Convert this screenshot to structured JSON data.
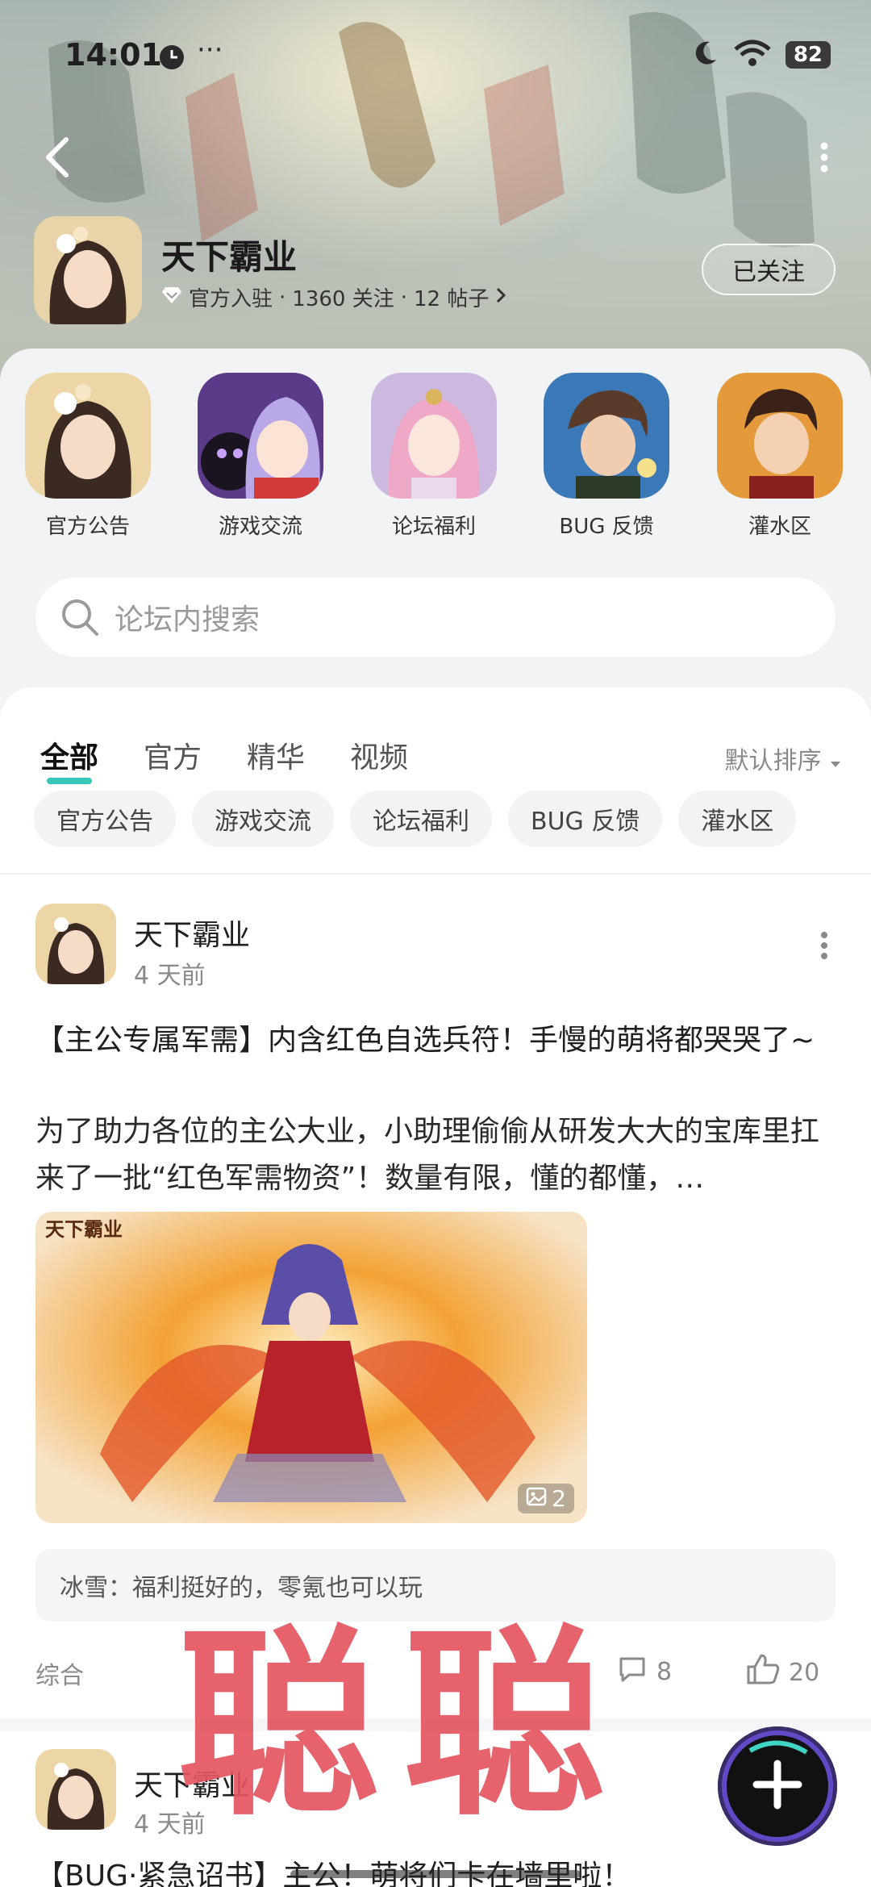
{
  "status_bar": {
    "time": "14:01",
    "battery": "82"
  },
  "forum": {
    "title": "天下霸业",
    "meta_verified": "官方入驻",
    "meta_follow": "1360 关注",
    "meta_posts": "12 帖子",
    "follow_label": "已关注"
  },
  "categories": [
    {
      "label": "官方公告"
    },
    {
      "label": "游戏交流"
    },
    {
      "label": "论坛福利"
    },
    {
      "label": "BUG 反馈"
    },
    {
      "label": "灌水区"
    }
  ],
  "search": {
    "placeholder": "论坛内搜索"
  },
  "tabs": [
    {
      "label": "全部"
    },
    {
      "label": "官方"
    },
    {
      "label": "精华"
    },
    {
      "label": "视频"
    }
  ],
  "sort_label": "默认排序",
  "chips": [
    {
      "label": "官方公告"
    },
    {
      "label": "游戏交流"
    },
    {
      "label": "论坛福利"
    },
    {
      "label": "BUG 反馈"
    },
    {
      "label": "灌水区"
    }
  ],
  "posts": [
    {
      "author": "天下霸业",
      "time": "4 天前",
      "title": "【主公专属军需】内含红色自选兵符！手慢的萌将都哭哭了~",
      "body": "为了助力各位的主公大业，小助理偷偷从研发大大的宝库里扛来了一批“红色军需物资”！数量有限，懂的都懂，…",
      "image_count": "2",
      "comment_preview": "冰雪：福利挺好的，零氪也可以玩",
      "tag": "综合",
      "comments": "8",
      "likes": "20"
    },
    {
      "author": "天下霸业",
      "time": "4 天前",
      "title": "【BUG·紧急诏书】主公！萌将们卡在墙里啦！"
    }
  ],
  "watermark": "聪聪",
  "colors": {
    "accent": "#34c7b9",
    "watermark": "#e45560"
  }
}
